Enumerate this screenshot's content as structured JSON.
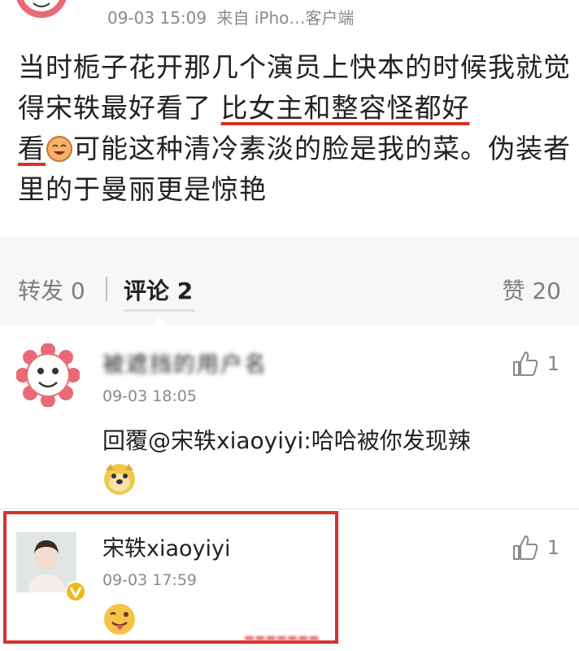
{
  "post": {
    "meta": {
      "time": "09-03 15:09",
      "source": "来自 iPho…客户端"
    },
    "text_parts": {
      "part1": "当时栀子花开那几个演员上快本的时候我就觉得宋轶最好看了 ",
      "underline1": "比女主和整容怪都好",
      "underline2": "看",
      "part2": "可能这种清冷素淡的脸是我的菜。伪装者里的于曼丽更是惊艳"
    },
    "emoji_icon": "laughing-face-icon"
  },
  "stats_bar": {
    "repost": "转发 0",
    "comments": "评论 2",
    "likes": "赞 20"
  },
  "comments": [
    {
      "author": "被遮挡的用户名",
      "time": "09-03 18:05",
      "text": "回覆@宋轶xiaoyiyi:哈哈被你发现辣",
      "like_count": "1",
      "avatar_icon": "flower-face-avatar",
      "emoji_icon": "doge-emoji-icon"
    },
    {
      "author": "宋轶xiaoyiyi",
      "time": "09-03 17:59",
      "like_count": "1",
      "avatar_icon": "user-photo-avatar",
      "badge_icon": "verified-v-badge-icon",
      "emoji_icon": "tongue-out-emoji-icon"
    }
  ],
  "colors": {
    "highlight": "#d7322c",
    "underline": "#d4342b",
    "verified": "#f2b81b"
  }
}
